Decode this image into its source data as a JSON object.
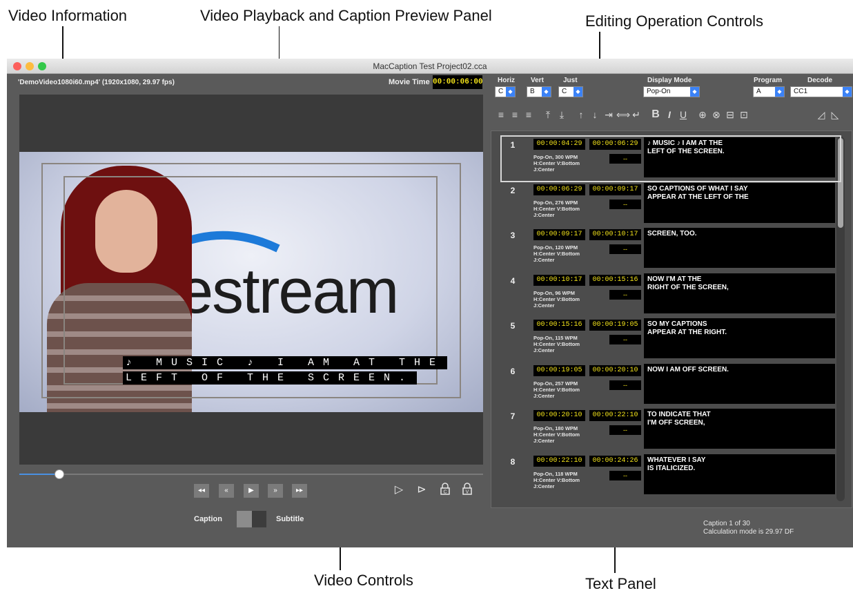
{
  "callouts": {
    "video_information": "Video Information",
    "video_playback_panel": "Video Playback and Caption Preview Panel",
    "editing_controls": "Editing Operation Controls",
    "video_controls": "Video Controls",
    "text_panel": "Text Panel"
  },
  "window": {
    "title": "MacCaption Test Project02.cca",
    "traffic_colors": [
      "#fc605c",
      "#fdbc40",
      "#34c84a"
    ]
  },
  "video_info": "'DemoVideo1080i60.mp4'  (1920x1080, 29.97 fps)",
  "movie_time": {
    "label": "Movie Time",
    "value": "00:00:06:00"
  },
  "preview": {
    "brand_text": "estream",
    "caption_line1": "♪ MUSIC ♪ I AM AT THE",
    "caption_line2": "LEFT OF THE SCREEN."
  },
  "scrubber": {
    "position_fraction": 0.086
  },
  "video_controls": {
    "buttons": [
      {
        "name": "skip-start-button",
        "glyph": "◂◂"
      },
      {
        "name": "rewind-button",
        "glyph": "«"
      },
      {
        "name": "play-button",
        "glyph": "▶"
      },
      {
        "name": "fast-forward-button",
        "glyph": "»"
      },
      {
        "name": "skip-end-button",
        "glyph": "▸▸"
      }
    ],
    "caption_label": "Caption",
    "subtitle_label": "Subtitle"
  },
  "editing_controls": {
    "horiz": {
      "label": "Horiz",
      "value": "C"
    },
    "vert": {
      "label": "Vert",
      "value": "B"
    },
    "just": {
      "label": "Just",
      "value": "C"
    },
    "display_mode": {
      "label": "Display Mode",
      "value": "Pop-On"
    },
    "program": {
      "label": "Program",
      "value": "A"
    },
    "decode": {
      "label": "Decode",
      "value": "CC1"
    }
  },
  "captions": [
    {
      "num": "1",
      "in": "00:00:04:29",
      "out": "00:00:06:29",
      "meta1": "Pop-On, 300 WPM",
      "meta2": "H:Center V:Bottom",
      "meta3": "J:Center",
      "dash": "--",
      "text": "♪ MUSIC ♪ I AM AT THE\nLEFT OF THE SCREEN."
    },
    {
      "num": "2",
      "in": "00:00:06:29",
      "out": "00:00:09:17",
      "meta1": "Pop-On, 276 WPM",
      "meta2": "H:Center V:Bottom",
      "meta3": "J:Center",
      "dash": "--",
      "text": "SO CAPTIONS OF WHAT I SAY\nAPPEAR AT THE LEFT OF THE"
    },
    {
      "num": "3",
      "in": "00:00:09:17",
      "out": "00:00:10:17",
      "meta1": "Pop-On, 120 WPM",
      "meta2": "H:Center V:Bottom",
      "meta3": "J:Center",
      "dash": "--",
      "text": "SCREEN, TOO."
    },
    {
      "num": "4",
      "in": "00:00:10:17",
      "out": "00:00:15:16",
      "meta1": "Pop-On, 96 WPM",
      "meta2": "H:Center V:Bottom",
      "meta3": "J:Center",
      "dash": "--",
      "text": "NOW I'M AT THE\nRIGHT OF THE SCREEN,"
    },
    {
      "num": "5",
      "in": "00:00:15:16",
      "out": "00:00:19:05",
      "meta1": "Pop-On, 115 WPM",
      "meta2": "H:Center V:Bottom",
      "meta3": "J:Center",
      "dash": "--",
      "text": "SO MY CAPTIONS\nAPPEAR AT THE RIGHT."
    },
    {
      "num": "6",
      "in": "00:00:19:05",
      "out": "00:00:20:10",
      "meta1": "Pop-On, 257 WPM",
      "meta2": "H:Center V:Bottom",
      "meta3": "J:Center",
      "dash": "--",
      "text": "NOW I AM OFF SCREEN."
    },
    {
      "num": "7",
      "in": "00:00:20:10",
      "out": "00:00:22:10",
      "meta1": "Pop-On, 180 WPM",
      "meta2": "H:Center V:Bottom",
      "meta3": "J:Center",
      "dash": "--",
      "text": "TO INDICATE THAT\nI'M OFF SCREEN,"
    },
    {
      "num": "8",
      "in": "00:00:22:10",
      "out": "00:00:24:26",
      "meta1": "Pop-On, 118 WPM",
      "meta2": "H:Center V:Bottom",
      "meta3": "J:Center",
      "dash": "--",
      "text": "WHATEVER I SAY\nIS ITALICIZED."
    }
  ],
  "status": {
    "caption_count": "Caption 1 of 30",
    "calc_mode": "Calculation mode is 29.97 DF"
  }
}
